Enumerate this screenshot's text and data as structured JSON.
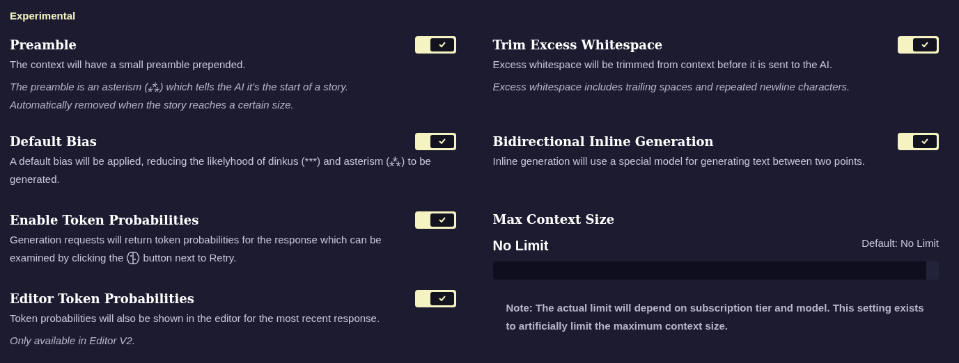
{
  "section_title": "Experimental",
  "settings": [
    {
      "kind": "toggle",
      "title": "Preamble",
      "on": true,
      "description": "The context will have a small preamble prepended.",
      "notes": [
        "The preamble is an asterism (⁂) which tells the AI it's the start of a story.",
        "Automatically removed when the story reaches a certain size."
      ]
    },
    {
      "kind": "toggle",
      "title": "Trim Excess Whitespace",
      "on": true,
      "description": "Excess whitespace will be trimmed from context before it is sent to the AI.",
      "notes": [
        "Excess whitespace includes trailing spaces and repeated newline characters."
      ]
    },
    {
      "kind": "toggle",
      "title": "Default Bias",
      "on": true,
      "description": "A default bias will be applied, reducing the likelyhood of dinkus (***) and asterism (⁂) to be generated."
    },
    {
      "kind": "toggle",
      "title": "Bidirectional Inline Generation",
      "on": true,
      "description": "Inline generation will use a special model for generating text between two points."
    },
    {
      "kind": "toggle",
      "title": "Enable Token Probabilities",
      "on": true,
      "description": "Generation requests will return token probabilities for the response which can be",
      "icon_line": {
        "before": "examined by clicking the",
        "after": "button next to Retry."
      }
    },
    {
      "kind": "slider",
      "title": "Max Context Size",
      "value": "No Limit",
      "default": "Default: No Limit",
      "level": 1,
      "note": "Note: The actual limit will depend on subscription tier and model. This setting exists to artificially limit the maximum context size."
    },
    {
      "kind": "toggle",
      "title": "Editor Token Probabilities",
      "on": true,
      "description": "Token probabilities will also be shown in the editor for the most recent response.",
      "notes": [
        "Only available in Editor V2."
      ]
    }
  ]
}
